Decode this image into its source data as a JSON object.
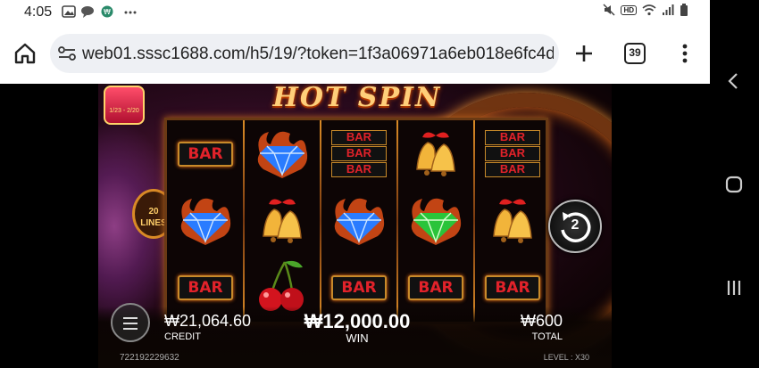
{
  "status_bar": {
    "time": "4:05",
    "icons": [
      "gallery-icon",
      "chat-icon",
      "app-notification-icon",
      "more-dots-icon"
    ],
    "right_icons": [
      "mute-icon",
      "hd-voice-icon",
      "wifi-icon",
      "signal-icon",
      "battery-icon"
    ],
    "hd_label": "HD"
  },
  "browser": {
    "url": "web01.sssc1688.com/h5/19/?token=1f3a06971a6eb018e6fc4d",
    "tab_count": "39"
  },
  "game": {
    "logo": "HOT SPIN",
    "promo_dates": "1/23 - 2/20",
    "lines_number": "20",
    "lines_label": "LINES",
    "reels": [
      [
        "bar1",
        "diamond-blue",
        "bar1"
      ],
      [
        "diamond-blue",
        "bell",
        "cherry"
      ],
      [
        "bar3",
        "diamond-blue",
        "bar1"
      ],
      [
        "bell",
        "diamond-green",
        "bar1"
      ],
      [
        "bar3",
        "bell",
        "bar1"
      ]
    ],
    "bar_text": "BAR",
    "spin_count": "2",
    "credit_value": "₩21,064.60",
    "credit_label": "CREDIT",
    "win_value": "₩12,000.00",
    "win_label": "WIN",
    "total_value": "₩600",
    "total_label": "TOTAL",
    "round_id": "722192229632",
    "level": "LEVEL : X30"
  },
  "colors": {
    "bar_red": "#e2222a",
    "gold_frame": "#c88a2a",
    "diamond_blue": "#2a7cff",
    "diamond_green": "#2ac43a"
  }
}
